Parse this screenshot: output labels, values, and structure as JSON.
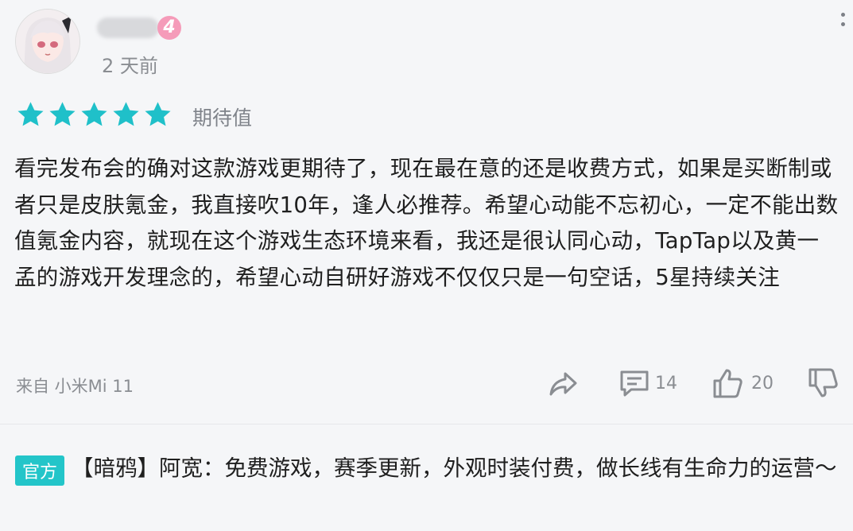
{
  "header": {
    "level": "4",
    "time": "2 天前"
  },
  "rating": {
    "stars": 5,
    "max_stars": 5,
    "label": "期待值",
    "star_color": "#1fc0c9"
  },
  "review": {
    "text": "看完发布会的确对这款游戏更期待了，现在最在意的还是收费方式，如果是买断制或者只是皮肤氪金，我直接吹10年，逢人必推荐。希望心动能不忘初心，一定不能出数值氪金内容，就现在这个游戏生态环境来看，我还是很认同心动，TapTap以及黄一孟的游戏开发理念的，希望心动自研好游戏不仅仅只是一句空话，5星持续关注"
  },
  "footer": {
    "device": "来自 小米Mi 11",
    "comment_count": "14",
    "like_count": "20"
  },
  "official_reply": {
    "badge": "官方",
    "text": "【暗鸦】阿宽：免费游戏，赛季更新，外观时装付费，做长线有生命力的运营～"
  },
  "icons": [
    "more-vertical-icon",
    "star-icon",
    "share-icon",
    "comment-icon",
    "thumbs-up-icon",
    "thumbs-down-icon"
  ],
  "colors": {
    "accent": "#1fc0c9",
    "badge_pink": "#f59bb9",
    "official_badge": "#23c5c9",
    "muted_text": "#8a8d92"
  }
}
